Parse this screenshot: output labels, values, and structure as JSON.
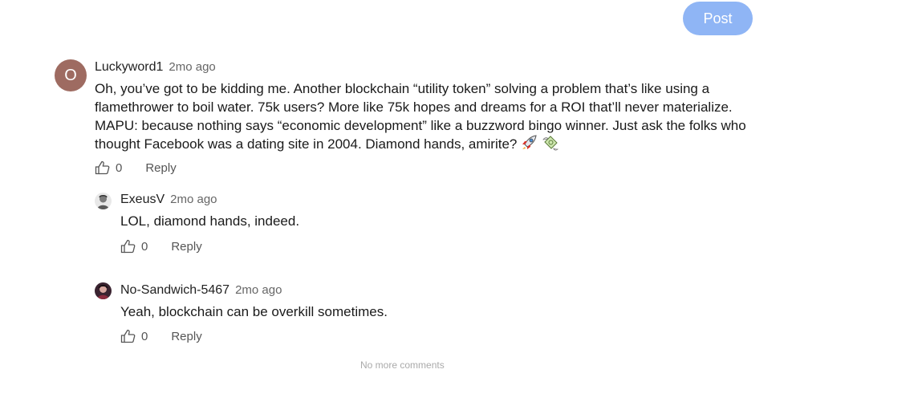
{
  "post_button": {
    "label": "Post"
  },
  "comments": [
    {
      "avatar": {
        "letter": "O",
        "color": "#9e6b61"
      },
      "author": "Luckyword1",
      "time": "2mo ago",
      "text": "Oh, you’ve got to be kidding me. Another blockchain “utility token” solving a problem that’s like using a flamethrower to boil water. 75k users? More like 75k hopes and dreams for a ROI that’ll never materialize. MAPU: because nothing says “economic development” like a buzzword bingo winner. Just ask the folks who thought Facebook was a dating site in 2004. Diamond hands, amirite?",
      "emojis": [
        "rocket-icon",
        "money-with-wings-icon"
      ],
      "likes": "0",
      "reply_label": "Reply"
    },
    {
      "avatar": {
        "icon": "user-avatar-photo"
      },
      "author": "ExeusV",
      "time": "2mo ago",
      "text": "LOL, diamond hands, indeed.",
      "likes": "0",
      "reply_label": "Reply"
    },
    {
      "avatar": {
        "icon": "user-avatar-photo"
      },
      "author": "No-Sandwich-5467",
      "time": "2mo ago",
      "text": "Yeah, blockchain can be overkill sometimes.",
      "likes": "0",
      "reply_label": "Reply"
    }
  ],
  "footer": {
    "no_more_label": "No more comments"
  },
  "colors": {
    "post_button": "#8fb5f5",
    "avatar_letter_bg": "#9e6b61",
    "muted_text": "#666666"
  }
}
